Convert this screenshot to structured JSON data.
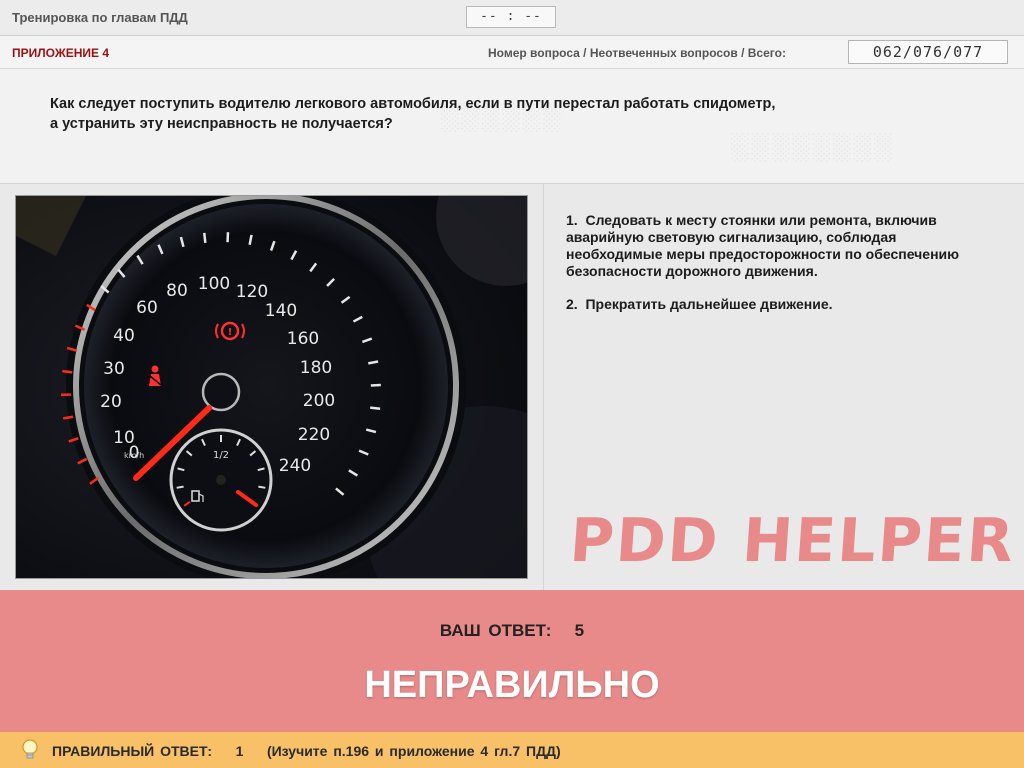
{
  "header": {
    "title": "Тренировка по главам ПДД",
    "timer": "-- : --"
  },
  "subheader": {
    "section": "ПРИЛОЖЕНИЕ 4",
    "counter_label": "Номер вопроса / Неотвеченных вопросов / Всего:",
    "counter_value": "062/076/077"
  },
  "question": {
    "text_line1": "Как следует поступить водителю легкового автомобиля, если в пути перестал работать спидометр,",
    "text_line2": "а устранить эту неисправность не получается?"
  },
  "image": {
    "subject": "speedometer",
    "speed_ticks": [
      "0",
      "10",
      "20",
      "30",
      "40",
      "60",
      "80",
      "100",
      "120",
      "140",
      "160",
      "180",
      "200",
      "220",
      "240"
    ],
    "unit": "km/h",
    "fuel_label": "1/2"
  },
  "answers": [
    {
      "num": "1.",
      "text": "Следовать к месту стоянки или ремонта, включив аварийную световую сигнализацию, соблюдая необходимые меры предосторожности по обеспечению безопасности дорожного движения."
    },
    {
      "num": "2.",
      "text": "Прекратить дальнейшее движение."
    }
  ],
  "brand": "PDD HELPER",
  "result": {
    "your_answer_label": "ВАШ ОТВЕТ:",
    "your_answer_value": "5",
    "verdict": "НЕПРАВИЛЬНО"
  },
  "footer": {
    "correct_label": "ПРАВИЛЬНЫЙ ОТВЕТ:",
    "correct_value": "1",
    "hint": "(Изучите п.196 и приложение 4 гл.7 ПДД)"
  },
  "colors": {
    "section_red": "#9b1111",
    "result_bg": "#e98a8a",
    "footer_bg": "#f8c168",
    "brand": "#e88a8a"
  }
}
